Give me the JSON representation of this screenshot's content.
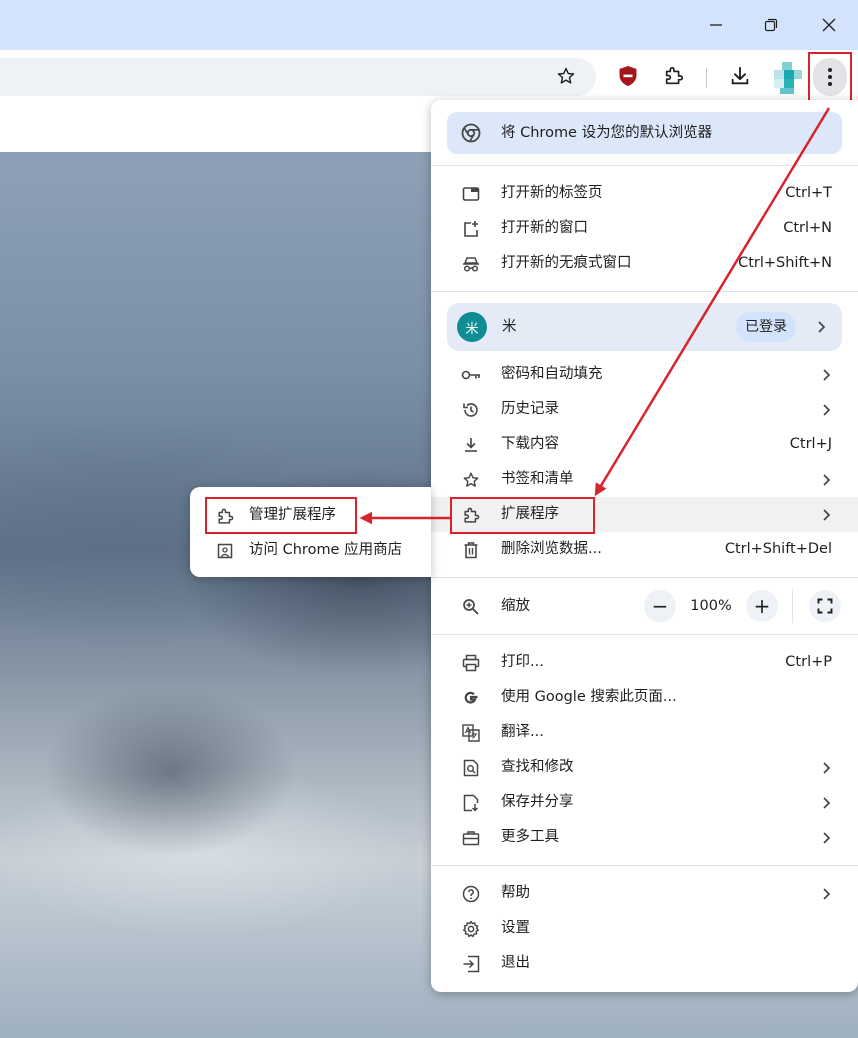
{
  "window": {
    "controls": [
      "minimize",
      "restore",
      "close"
    ]
  },
  "menu": {
    "set_default": "将 Chrome 设为您的默认浏览器",
    "group1": [
      {
        "label": "打开新的标签页",
        "shortcut": "Ctrl+T"
      },
      {
        "label": "打开新的窗口",
        "shortcut": "Ctrl+N"
      },
      {
        "label": "打开新的无痕式窗口",
        "shortcut": "Ctrl+Shift+N"
      }
    ],
    "profile": {
      "avatar_text": "米",
      "name": "米",
      "status": "已登录"
    },
    "group2": [
      {
        "label": "密码和自动填充"
      },
      {
        "label": "历史记录"
      },
      {
        "label": "下载内容",
        "shortcut": "Ctrl+J"
      },
      {
        "label": "书签和清单"
      },
      {
        "label": "扩展程序"
      },
      {
        "label": "删除浏览数据...",
        "shortcut": "Ctrl+Shift+Del"
      }
    ],
    "zoom": {
      "label": "缩放",
      "minus": "−",
      "value": "100%",
      "plus": "+"
    },
    "group3": [
      {
        "label": "打印...",
        "shortcut": "Ctrl+P"
      },
      {
        "label": "使用 Google 搜索此页面..."
      },
      {
        "label": "翻译..."
      },
      {
        "label": "查找和修改"
      },
      {
        "label": "保存并分享"
      },
      {
        "label": "更多工具"
      }
    ],
    "group4": [
      {
        "label": "帮助"
      },
      {
        "label": "设置"
      },
      {
        "label": "退出"
      }
    ]
  },
  "submenu": {
    "items": [
      {
        "label": "管理扩展程序"
      },
      {
        "label": "访问 Chrome 应用商店"
      }
    ]
  },
  "colors": {
    "accent": "#d3e3fd",
    "highlight": "#d9232b",
    "avatar": "#0e8e94"
  }
}
